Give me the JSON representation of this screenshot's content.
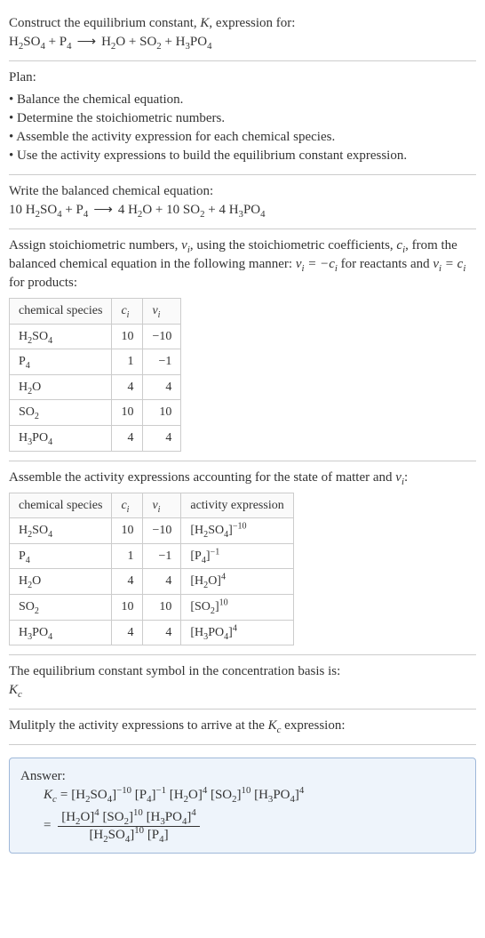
{
  "intro": {
    "line1_prefix": "Construct the equilibrium constant, ",
    "line1_K": "K",
    "line1_suffix": ", expression for:"
  },
  "plan": {
    "heading": "Plan:",
    "items": [
      "Balance the chemical equation.",
      "Determine the stoichiometric numbers.",
      "Assemble the activity expression for each chemical species.",
      "Use the activity expressions to build the equilibrium constant expression."
    ]
  },
  "balanced_heading": "Write the balanced chemical equation:",
  "stoich": {
    "text_a": "Assign stoichiometric numbers, ",
    "text_b": ", using the stoichiometric coefficients, ",
    "text_c": ", from the balanced chemical equation in the following manner: ",
    "text_d": " for reactants and ",
    "text_e": " for products:",
    "nu": "ν",
    "c": "c",
    "i": "i",
    "eq_reactants": " = −",
    "eq_products": " = "
  },
  "table1": {
    "headers": {
      "species": "chemical species",
      "c": "c",
      "nu": "ν",
      "i": "i"
    },
    "rows": [
      {
        "c": "10",
        "nu": "−10"
      },
      {
        "c": "1",
        "nu": "−1"
      },
      {
        "c": "4",
        "nu": "4"
      },
      {
        "c": "10",
        "nu": "10"
      },
      {
        "c": "4",
        "nu": "4"
      }
    ]
  },
  "activity_heading_a": "Assemble the activity expressions accounting for the state of matter and ",
  "activity_heading_b": ":",
  "table2": {
    "headers": {
      "species": "chemical species",
      "c": "c",
      "nu": "ν",
      "i": "i",
      "act": "activity expression"
    },
    "rows": [
      {
        "c": "10",
        "nu": "−10",
        "exp": "−10"
      },
      {
        "c": "1",
        "nu": "−1",
        "exp": "−1"
      },
      {
        "c": "4",
        "nu": "4",
        "exp": "4"
      },
      {
        "c": "10",
        "nu": "10",
        "exp": "10"
      },
      {
        "c": "4",
        "nu": "4",
        "exp": "4"
      }
    ]
  },
  "kc_basis_a": "The equilibrium constant symbol in the concentration basis is:",
  "kc_K": "K",
  "kc_c": "c",
  "multiply_a": "Mulitply the activity expressions to arrive at the ",
  "multiply_b": " expression:",
  "answer_label": "Answer:",
  "coeffs": {
    "h2so4": "10",
    "p4": "1",
    "h2o": "4",
    "so2": "10",
    "h3po4": "4",
    "exp_h2so4": "−10",
    "exp_p4": "−1",
    "exp_h2o": "4",
    "exp_so2": "10",
    "exp_h3po4": "4"
  },
  "chart_data": {
    "type": "table",
    "tables": [
      {
        "title": "Stoichiometric numbers",
        "columns": [
          "chemical species",
          "c_i",
          "ν_i"
        ],
        "rows": [
          [
            "H2SO4",
            10,
            -10
          ],
          [
            "P4",
            1,
            -1
          ],
          [
            "H2O",
            4,
            4
          ],
          [
            "SO2",
            10,
            10
          ],
          [
            "H3PO4",
            4,
            4
          ]
        ]
      },
      {
        "title": "Activity expressions",
        "columns": [
          "chemical species",
          "c_i",
          "ν_i",
          "activity expression"
        ],
        "rows": [
          [
            "H2SO4",
            10,
            -10,
            "[H2SO4]^(-10)"
          ],
          [
            "P4",
            1,
            -1,
            "[P4]^(-1)"
          ],
          [
            "H2O",
            4,
            4,
            "[H2O]^4"
          ],
          [
            "SO2",
            10,
            10,
            "[SO2]^10"
          ],
          [
            "H3PO4",
            4,
            4,
            "[H3PO4]^4"
          ]
        ]
      }
    ]
  }
}
